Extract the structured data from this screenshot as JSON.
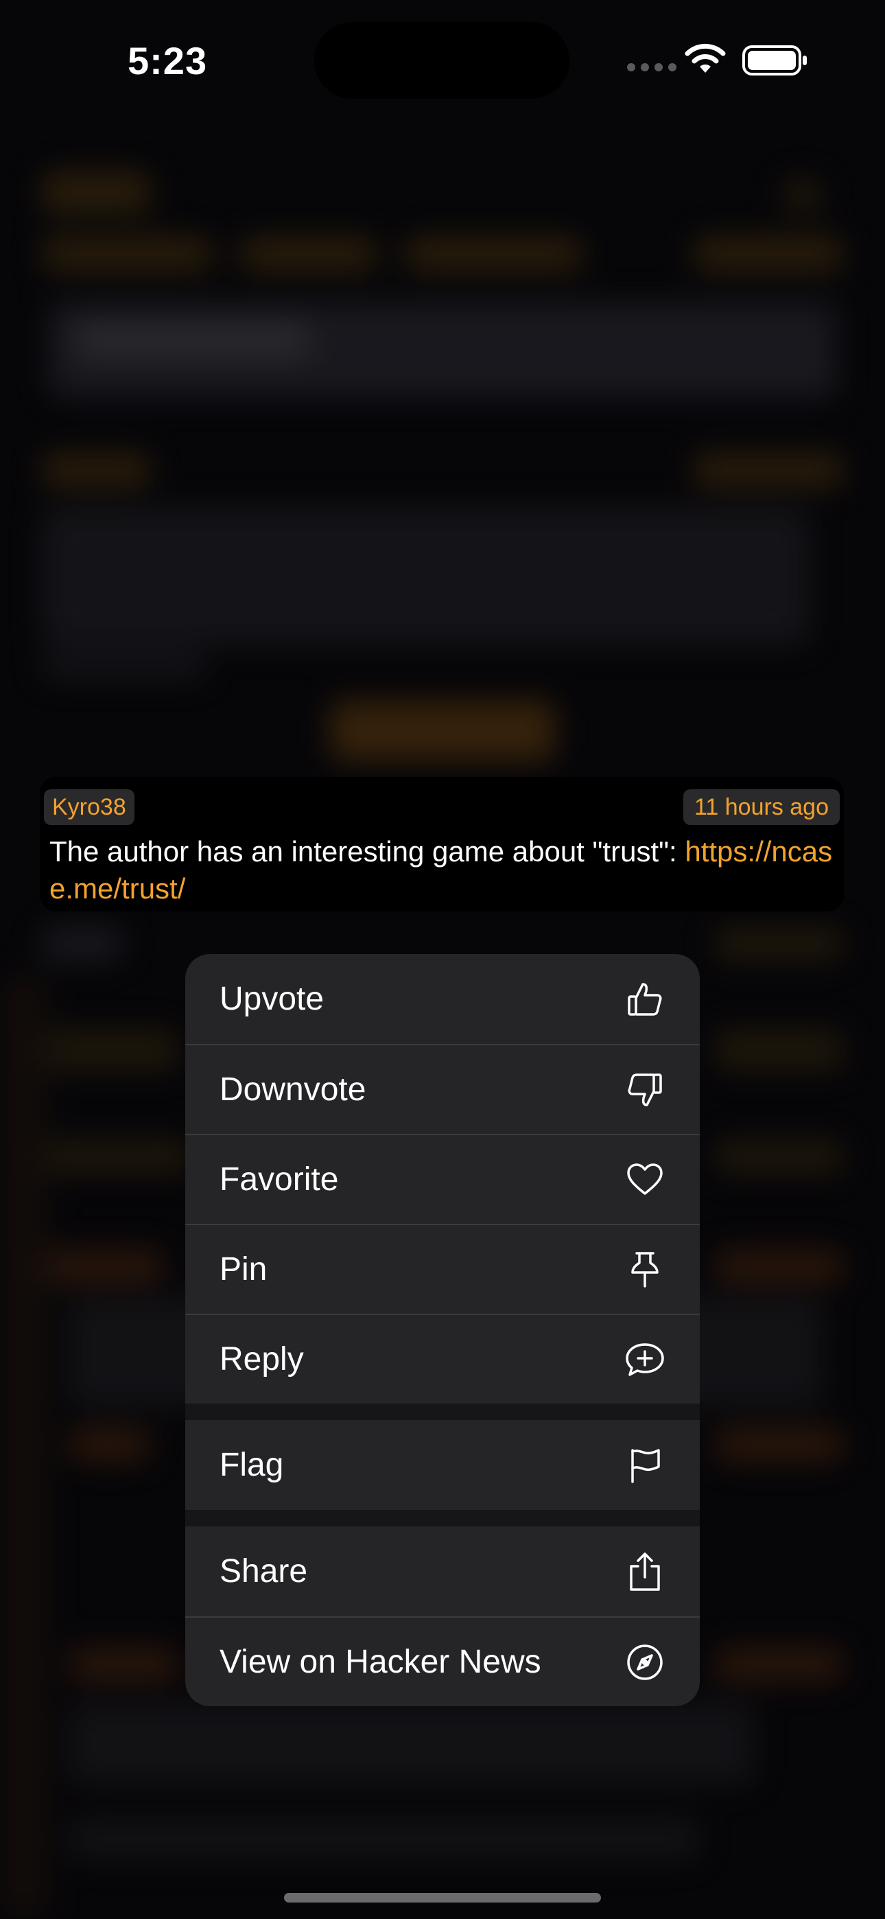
{
  "status_bar": {
    "time": "5:23"
  },
  "comment": {
    "author": "Kyro38",
    "time": "11 hours ago",
    "text": "The author has an interesting game about \"trust\": ",
    "link": "https://ncase.me/trust/"
  },
  "menu": {
    "items": [
      {
        "label": "Upvote",
        "icon": "thumbs-up-icon"
      },
      {
        "label": "Downvote",
        "icon": "thumbs-down-icon"
      },
      {
        "label": "Favorite",
        "icon": "heart-icon"
      },
      {
        "label": "Pin",
        "icon": "pin-icon"
      },
      {
        "label": "Reply",
        "icon": "reply-bubble-plus-icon"
      },
      {
        "label": "Flag",
        "icon": "flag-icon"
      },
      {
        "label": "Share",
        "icon": "share-icon"
      },
      {
        "label": "View on Hacker News",
        "icon": "compass-icon"
      }
    ]
  },
  "colors": {
    "accent": "#f3a22d",
    "menu_bg": "#252527",
    "background": "#08070b"
  }
}
